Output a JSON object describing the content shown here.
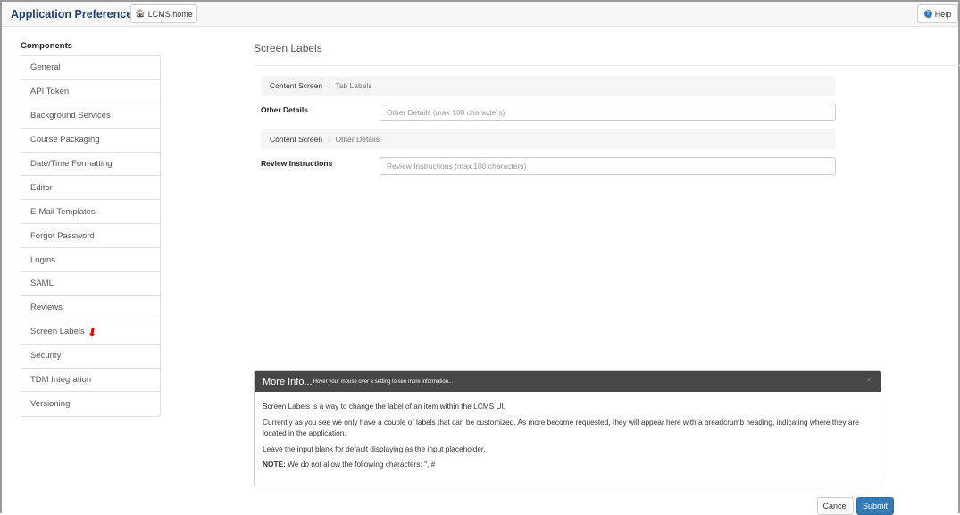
{
  "header": {
    "title": "Application Preferences",
    "home_label": "LCMS home",
    "help_label": "Help"
  },
  "sidebar": {
    "heading": "Components",
    "items": [
      {
        "label": "General"
      },
      {
        "label": "API Token"
      },
      {
        "label": "Background Services"
      },
      {
        "label": "Course Packaging"
      },
      {
        "label": "Date/Time Formatting"
      },
      {
        "label": "Editor"
      },
      {
        "label": "E-Mail Templates"
      },
      {
        "label": "Forgot Password"
      },
      {
        "label": "Logins"
      },
      {
        "label": "SAML"
      },
      {
        "label": "Reviews"
      },
      {
        "label": "Screen Labels"
      },
      {
        "label": "Security"
      },
      {
        "label": "TDM Integration"
      },
      {
        "label": "Versioning"
      }
    ]
  },
  "main": {
    "title": "Screen Labels",
    "sections": [
      {
        "crumb": [
          "Content Screen",
          "Tab Labels"
        ],
        "label": "Other Details",
        "placeholder": "Other Details (max 100 characters)",
        "value": ""
      },
      {
        "crumb": [
          "Content Screen",
          "Other Details"
        ],
        "label": "Review Instructions",
        "placeholder": "Review Instructions (max 100 characters)",
        "value": ""
      }
    ]
  },
  "info": {
    "title": "More Info...",
    "subtitle": "Hover your mouse over a setting to see more information...",
    "close": "×",
    "p1": "Screen Labels is a way to change the label of an item within the LCMS UI.",
    "p2": "Currently as you see we only have a couple of labels that can be customized. As more become requested, they will appear here with a breadcrumb heading, indicating where they are located in the application.",
    "p3": "Leave the input blank for default displaying as the input placeholder.",
    "note_label": "NOTE:",
    "note": " We do not allow the following characters: \", #"
  },
  "actions": {
    "cancel": "Cancel",
    "submit": "Submit"
  },
  "colors": {
    "accent": "#337ab7",
    "title": "#1d3f6e"
  }
}
